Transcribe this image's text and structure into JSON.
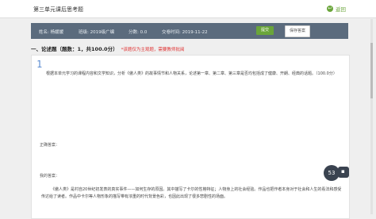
{
  "header": {
    "title": "第三单元课后思考题",
    "back_label": "返回"
  },
  "info": {
    "name": "姓名: 杨媛媛",
    "class": "班级: 2019级广编",
    "score": "分数: 0.0",
    "time": "交卷时间: 2019-11-22",
    "submit": "提交",
    "save": "保存答案"
  },
  "section": {
    "title": "一、论述题（题数：1，共100.0分）",
    "note": "*该题仅为主观题，需要教师批阅"
  },
  "question": {
    "number": "1",
    "text": "根据本单元学习的课程内容和文学知识，分析《傲人类》的故事情节和人物关系，论述第一章、第二章、第三章是否均包括成了健康、开朗、经典的话题。（100.0分）",
    "label1": "正确答案：",
    "label2": "我的答案："
  },
  "answer": {
    "text": "《傲人类》是村自20世纪初发表的真实事件——如何生存的原因。其中描写了卡尔的性格特征；人物身上的社会经验。作品也把作者本身对于社会和人生的看法和感受传达给了读者。作品中卡尔等人物形象的描写带有浓重的时代背景色彩，也因此出现了很多悲剧性的场面。"
  },
  "timer": {
    "value": "53"
  }
}
